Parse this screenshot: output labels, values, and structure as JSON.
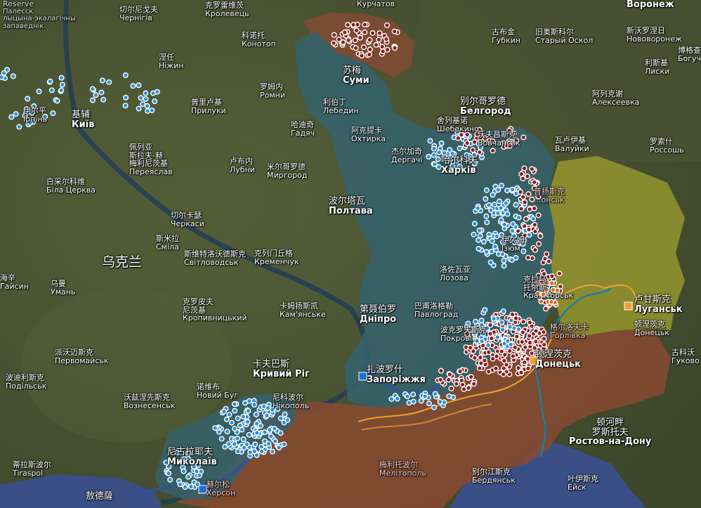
{
  "map": {
    "colors": {
      "ukraine_base": "#485431",
      "russia_base": "#4a4f33",
      "blue_zone": "#35636e",
      "occupied": "#8b4a32",
      "lpr": "#9a9a2e",
      "sea": "#3a4f86",
      "river": "#2f52a0",
      "dot_blue": "#2e8fd6",
      "dot_red": "#8a1e1e",
      "dot_orange": "#d9691a",
      "front_line": "#f0a030"
    },
    "markers": [
      {
        "name": "zaporizhzhia-marker",
        "color": "#1f6fd0"
      },
      {
        "name": "kherson-marker",
        "color": "#1f6fd0"
      },
      {
        "name": "donetsk-marker",
        "color": "#f0a030"
      },
      {
        "name": "luhansk-marker",
        "color": "#f0a030"
      }
    ]
  },
  "labels": [
    {
      "id": "reserve",
      "cn": "Reserve",
      "ru": "Палесск",
      "ru2": "лыцына-экалагічны",
      "ru3": "запаведнік"
    },
    {
      "id": "chernihiv",
      "cn": "切尔尼戈夫",
      "ru": "Чернігів"
    },
    {
      "id": "korolevets",
      "cn": "克罗雷维茨",
      "ru": "Кролевець"
    },
    {
      "id": "kurchatov",
      "cn": "",
      "ru": "Курчатов"
    },
    {
      "id": "voronezh",
      "cn": "",
      "ru": "Воронеж"
    },
    {
      "id": "konotop",
      "cn": "科诺托",
      "ru": "Конотоп"
    },
    {
      "id": "gubkin",
      "cn": "古布金",
      "ru": "Губкин"
    },
    {
      "id": "stary-oskol",
      "cn": "旧奥斯科尔",
      "ru": "Старый Оскол"
    },
    {
      "id": "novovoronezh",
      "cn": "新沃罗涅日",
      "ru": "Нововоронеж"
    },
    {
      "id": "nizhyn",
      "cn": "涅任",
      "ru": "Ніжин"
    },
    {
      "id": "sumy",
      "cn": "苏梅",
      "ru": "Суми"
    },
    {
      "id": "romny",
      "cn": "罗姆内",
      "ru": "Ромни"
    },
    {
      "id": "liski",
      "cn": "利斯基",
      "ru": "Лиски"
    },
    {
      "id": "boguchar",
      "cn": "博格查尔",
      "ru": "Богучар"
    },
    {
      "id": "kyiv",
      "cn": "基辅",
      "ru": "Київ"
    },
    {
      "id": "irpin",
      "cn": "伊尔平",
      "ru": "Ірпінь"
    },
    {
      "id": "pryluky",
      "cn": "普里卢基",
      "ru": "Прилуки"
    },
    {
      "id": "lebedyn",
      "cn": "利伯丁",
      "ru": "Лебедин"
    },
    {
      "id": "belgorod",
      "cn": "别尔哥罗德",
      "ru": "Белгород"
    },
    {
      "id": "alekseevka",
      "cn": "阿列克谢",
      "ru": "Алексеевка"
    },
    {
      "id": "rossosh",
      "cn": "罗索什",
      "ru": "Россошь"
    },
    {
      "id": "shebekino",
      "cn": "舍列基诺",
      "ru": "Шебекино"
    },
    {
      "id": "okhtyrka",
      "cn": "阿克提卡",
      "ru": "Охтирка"
    },
    {
      "id": "hadiach",
      "cn": "哈迪奇",
      "ru": "Гадяч"
    },
    {
      "id": "vovchansk",
      "cn": "沃夫昌斯克",
      "ru": "Вовчанськ"
    },
    {
      "id": "valuyki",
      "cn": "瓦卢伊基",
      "ru": "Валуйки"
    },
    {
      "id": "pereiaslav",
      "cn": "佩列亚\n斯拉夫-赫\n梅利尼茨基",
      "ru": "Переяслав"
    },
    {
      "id": "derhachi",
      "cn": "杰尔加奇",
      "ru": "Дергачі"
    },
    {
      "id": "kharkiv",
      "cn": "哈尔科夫",
      "ru": "Харків"
    },
    {
      "id": "lubny",
      "cn": "卢布内",
      "ru": "Лубни"
    },
    {
      "id": "myrhorod",
      "cn": "米尔哥罗德",
      "ru": "Миргород"
    },
    {
      "id": "bila-tserkva",
      "cn": "白采尔科维",
      "ru": "Біла Церква"
    },
    {
      "id": "lysychansk",
      "cn": "普扬斯克",
      "ru": "...онськ"
    },
    {
      "id": "poltava",
      "cn": "波尔塔瓦",
      "ru": "Полтава"
    },
    {
      "id": "cherkasy",
      "cn": "切尔卡瑟",
      "ru": "Черкаси"
    },
    {
      "id": "smila",
      "cn": "斯米拉",
      "ru": "Сміла"
    },
    {
      "id": "izium",
      "cn": "伊久姆",
      "ru": "Ізюм"
    },
    {
      "id": "ukraine",
      "cn": "乌克兰",
      "ru": ""
    },
    {
      "id": "svitlovodsk",
      "cn": "斯维特洛沃德斯克",
      "ru": "Світловодськ"
    },
    {
      "id": "kremenchuk",
      "cn": "克列门丘格",
      "ru": "Кременчук"
    },
    {
      "id": "lozova",
      "cn": "洛佐瓦亚",
      "ru": "Лозова"
    },
    {
      "id": "haisyn",
      "cn": "海辛",
      "ru": "Гайсин"
    },
    {
      "id": "uman",
      "cn": "乌曼",
      "ru": "Умань"
    },
    {
      "id": "kramatorsk",
      "cn": "克拉马\n托尔斯",
      "ru": "Кра...торськ"
    },
    {
      "id": "luhansk",
      "cn": "卢甘斯克",
      "ru": "Луганськ"
    },
    {
      "id": "kropyvnytskyi",
      "cn": "克罗皮夫\n尼茨基",
      "ru": "Кропивницький"
    },
    {
      "id": "kamianske",
      "cn": "卡姆扬斯凯",
      "ru": "Кам'янське"
    },
    {
      "id": "dnipro",
      "cn": "第聂伯罗",
      "ru": "Дніпро"
    },
    {
      "id": "pavlohrad",
      "cn": "巴甫洛格勒",
      "ru": "Павлоград"
    },
    {
      "id": "horlivka",
      "cn": "格尔洛夫卡",
      "ru": "Горлівка"
    },
    {
      "id": "donetsk-town",
      "cn": "顿涅茨克",
      "ru": "Донецьк"
    },
    {
      "id": "pokrovsk",
      "cn": "波克罗夫斯克",
      "ru": "Покров..."
    },
    {
      "id": "pervomaisk",
      "cn": "派沃迈斯克",
      "ru": "Первомайськ"
    },
    {
      "id": "donetsk",
      "cn": "顿涅茨克",
      "ru": "Донецьк"
    },
    {
      "id": "zaporizhzhia",
      "cn": "扎波罗什",
      "ru": "Запоріжжя"
    },
    {
      "id": "kryvyi-rih",
      "cn": "卡夫巴斯",
      "ru": "Кривий Ріг"
    },
    {
      "id": "podilsk",
      "cn": "波迪利斯克",
      "ru": "Подільськ"
    },
    {
      "id": "voznesensk",
      "cn": "沃兹涅先斯克",
      "ru": "Вознесенськ"
    },
    {
      "id": "novyi-buh",
      "cn": "诺维布",
      "ru": "Новий Буг"
    },
    {
      "id": "nikopol",
      "cn": "尼科波尔",
      "ru": "Нікополь"
    },
    {
      "id": "mykolaiv",
      "cn": "尼古拉耶夫",
      "ru": "Миколаїв"
    },
    {
      "id": "rostov",
      "cn": "顿河畔\n罗斯托夫",
      "ru": "Ростов-на-Дону"
    },
    {
      "id": "melitopol",
      "cn": "梅利托波尔",
      "ru": "Мелітополь"
    },
    {
      "id": "tiraspol",
      "cn": "蒂拉斯波尔",
      "ru": "Tiraspol"
    },
    {
      "id": "berdiansk",
      "cn": "别尔江斯克",
      "ru": "Бердянськ"
    },
    {
      "id": "yeysk",
      "cn": "叶伊斯克",
      "ru": "Ейск"
    },
    {
      "id": "kherson",
      "cn": "赫尔松",
      "ru": "Херсон"
    },
    {
      "id": "odesa",
      "cn": "敖德薩",
      "ru": ""
    },
    {
      "id": "gukovo",
      "cn": "古科沃",
      "ru": "Гуково"
    }
  ]
}
